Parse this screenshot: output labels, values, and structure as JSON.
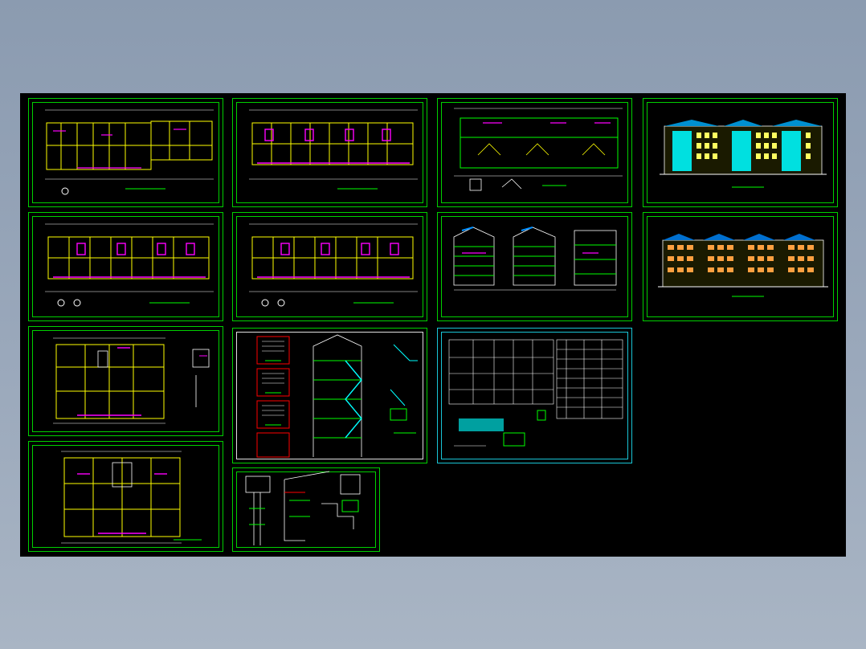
{
  "viewer": {
    "background_color": "#000000",
    "frame_color_primary": "#00d000",
    "frame_color_secondary": "#19c5d6",
    "line_colors": [
      "#ffff00",
      "#ff00ff",
      "#00ffff",
      "#ff0000",
      "#ffffff",
      "#00ff00"
    ]
  },
  "sheets": [
    {
      "id": "plan-ground",
      "kind": "floor-plan",
      "icon": "floor-plan-icon"
    },
    {
      "id": "plan-typical-a",
      "kind": "floor-plan",
      "icon": "floor-plan-icon"
    },
    {
      "id": "plan-roof",
      "kind": "roof-plan",
      "icon": "roof-plan-icon"
    },
    {
      "id": "elevation-front",
      "kind": "elevation",
      "icon": "elevation-icon"
    },
    {
      "id": "plan-typical-b",
      "kind": "floor-plan",
      "icon": "floor-plan-icon"
    },
    {
      "id": "plan-typical-c",
      "kind": "floor-plan",
      "icon": "floor-plan-icon"
    },
    {
      "id": "sections",
      "kind": "section",
      "icon": "section-icon"
    },
    {
      "id": "elevation-rear",
      "kind": "elevation",
      "icon": "elevation-icon"
    },
    {
      "id": "unit-plan-a",
      "kind": "unit-plan",
      "icon": "unit-plan-icon"
    },
    {
      "id": "stair-details",
      "kind": "detail",
      "icon": "stair-icon"
    },
    {
      "id": "design-notes-table",
      "kind": "table",
      "icon": "table-icon"
    },
    {
      "id": "unit-plan-b",
      "kind": "unit-plan",
      "icon": "unit-plan-icon"
    },
    {
      "id": "wall-details",
      "kind": "detail",
      "icon": "detail-icon"
    }
  ]
}
